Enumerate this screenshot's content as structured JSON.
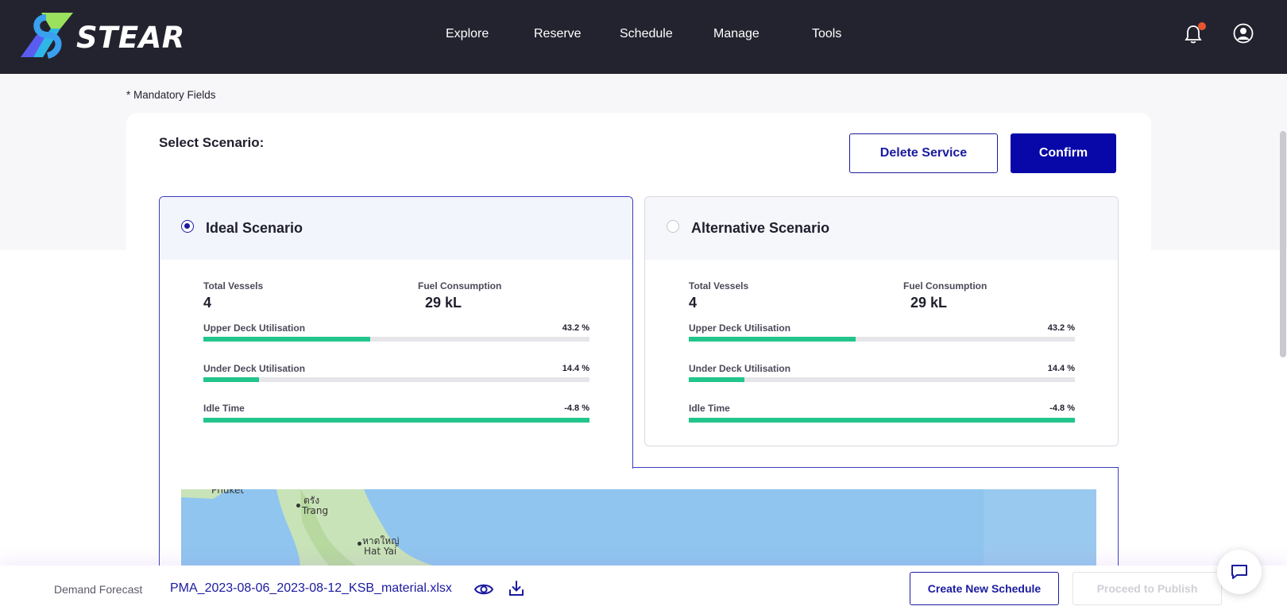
{
  "header": {
    "brand": "STEAR",
    "nav": [
      {
        "label": "Explore"
      },
      {
        "label": "Reserve"
      },
      {
        "label": "Schedule"
      },
      {
        "label": "Manage"
      },
      {
        "label": "Tools"
      }
    ],
    "icons": [
      "bell-icon",
      "user-icon"
    ],
    "notification_dot_color": "#e8542f"
  },
  "page": {
    "mandatory_note": "* Mandatory Fields",
    "select_title": "Select Scenario:",
    "delete_label": "Delete Service",
    "confirm_label": "Confirm"
  },
  "scenarios": [
    {
      "title": "Ideal Scenario",
      "selected": true,
      "total_vessels_label": "Total Vessels",
      "total_vessels": "4",
      "fuel_label": "Fuel Consumption",
      "fuel": "29 kL",
      "bars": [
        {
          "label": "Upper Deck Utilisation",
          "value_text": "43.2 %",
          "fill": 0.432
        },
        {
          "label": "Under Deck Utilisation",
          "value_text": "14.4 %",
          "fill": 0.144
        },
        {
          "label": "Idle Time",
          "value_text": "-4.8 %",
          "fill": 1.0
        }
      ]
    },
    {
      "title": "Alternative Scenario",
      "selected": false,
      "total_vessels_label": "Total Vessels",
      "total_vessels": "4",
      "fuel_label": "Fuel Consumption",
      "fuel": "29 kL",
      "bars": [
        {
          "label": "Upper Deck Utilisation",
          "value_text": "43.2 %",
          "fill": 0.432
        },
        {
          "label": "Under Deck Utilisation",
          "value_text": "14.4 %",
          "fill": 0.144
        },
        {
          "label": "Idle Time",
          "value_text": "-4.8 %",
          "fill": 1.0
        }
      ]
    }
  ],
  "map": {
    "labels": [
      "Phuket",
      "ตรัง",
      "Trang",
      "หาดใหญ่",
      "Hat Yai"
    ]
  },
  "footer": {
    "label": "Demand Forecast",
    "file": "PMA_2023-08-06_2023-08-12_KSB_material.xlsx",
    "create_label": "Create New Schedule",
    "publish_label": "Proceed to Publish"
  },
  "colors": {
    "primary": "#1a1aa0",
    "confirm_bg": "#0808a8",
    "bar_fill": "#22c58b",
    "header_bg": "#23232f"
  }
}
